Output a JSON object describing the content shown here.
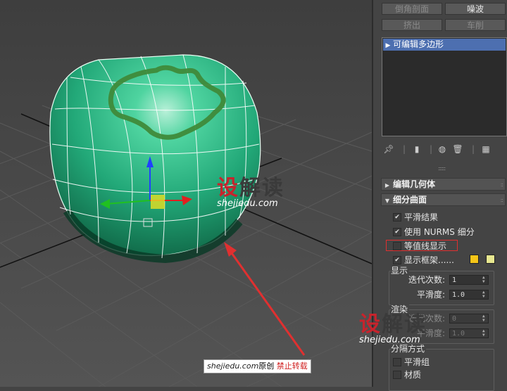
{
  "viewport": {
    "watermark_top": {
      "cn_left": "设",
      "cn_right": "解读",
      "en": "shejiedu.com"
    },
    "watermark_bottom": {
      "cn_left": "设",
      "cn_right": "解读",
      "en": "shejiedu.com"
    },
    "copyright": {
      "site": "shejiedu.com",
      "label": "原创",
      "warn": "禁止转载"
    }
  },
  "panel": {
    "buttons": [
      {
        "label": "倒角剖面",
        "active": false
      },
      {
        "label": "噪波",
        "active": true
      },
      {
        "label": "挤出",
        "active": false
      },
      {
        "label": "车削",
        "active": false
      }
    ],
    "stack_item": "可编辑多边形",
    "rollouts": {
      "edit_geometry": "编辑几何体",
      "subdivision_surface": "细分曲面"
    },
    "checkboxes": {
      "smooth_result": {
        "label": "平滑结果",
        "checked": true
      },
      "use_nurms": {
        "label": "使用 NURMS 细分",
        "checked": true
      },
      "isoline_display": {
        "label": "等值线显示",
        "checked": false
      },
      "show_cage": {
        "label": "显示框架......",
        "checked": true
      }
    },
    "cage_colors": [
      "#f5c518",
      "#e8e890"
    ],
    "display_group": {
      "title": "显示",
      "iterations_label": "迭代次数:",
      "iterations_value": "1",
      "smoothness_label": "平滑度:",
      "smoothness_value": "1.0"
    },
    "render_group": {
      "title": "渲染",
      "iterations_label": "迭代次数:",
      "iterations_value": "0",
      "smoothness_label": "平滑度:",
      "smoothness_value": "1.0"
    },
    "separate_group": {
      "title": "分隔方式",
      "smoothing_groups": "平滑组",
      "materials": "材质"
    }
  },
  "colors": {
    "object_green": "#2ec08a",
    "stroke_green": "#3f8a3a",
    "annotation_red": "#e03030",
    "selection_blue": "#4d6fb0"
  }
}
